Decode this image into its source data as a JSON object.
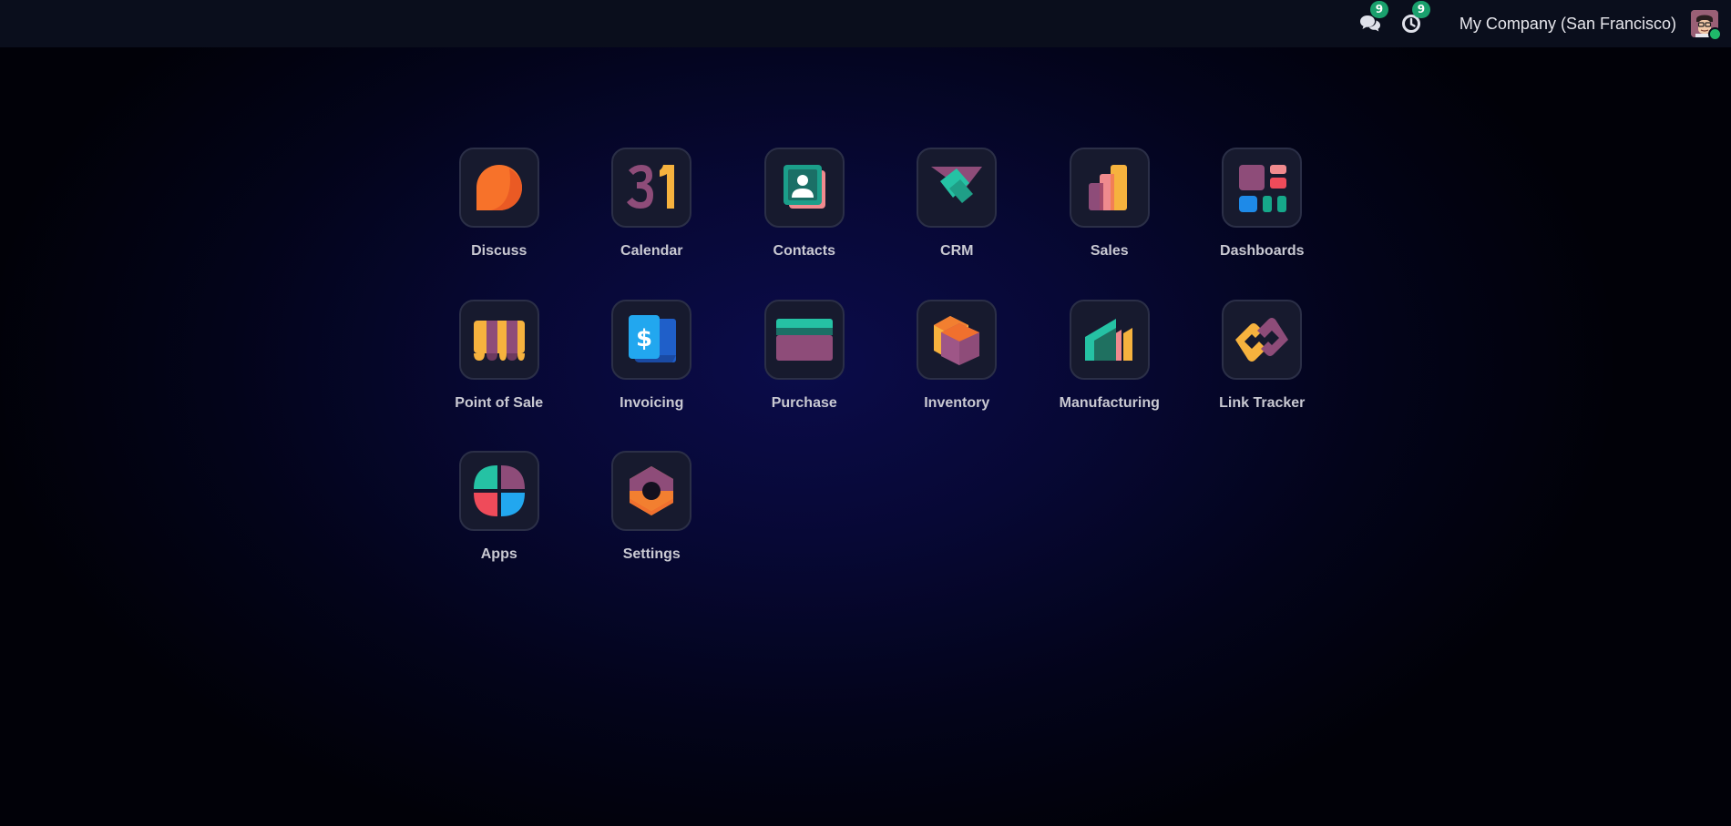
{
  "navbar": {
    "messages_badge": "9",
    "activities_badge": "9",
    "company_name": "My Company (San Francisco)",
    "online_status_color": "#1fb86a"
  },
  "apps": [
    {
      "label": "Discuss",
      "icon": "discuss-icon"
    },
    {
      "label": "Calendar",
      "icon": "calendar-icon"
    },
    {
      "label": "Contacts",
      "icon": "contacts-icon"
    },
    {
      "label": "CRM",
      "icon": "crm-icon"
    },
    {
      "label": "Sales",
      "icon": "sales-icon"
    },
    {
      "label": "Dashboards",
      "icon": "dashboards-icon"
    },
    {
      "label": "Point of Sale",
      "icon": "point-of-sale-icon"
    },
    {
      "label": "Invoicing",
      "icon": "invoicing-icon"
    },
    {
      "label": "Purchase",
      "icon": "purchase-icon"
    },
    {
      "label": "Inventory",
      "icon": "inventory-icon"
    },
    {
      "label": "Manufacturing",
      "icon": "manufacturing-icon"
    },
    {
      "label": "Link Tracker",
      "icon": "link-tracker-icon"
    },
    {
      "label": "Apps",
      "icon": "apps-icon"
    },
    {
      "label": "Settings",
      "icon": "settings-icon"
    }
  ],
  "calendar_icon_text": "31",
  "colors": {
    "navbar_bg": "#0a0e1c",
    "badge_green": "#1aa06d",
    "tile_bg": "#171a2e",
    "label_text": "#c9c9d2"
  }
}
